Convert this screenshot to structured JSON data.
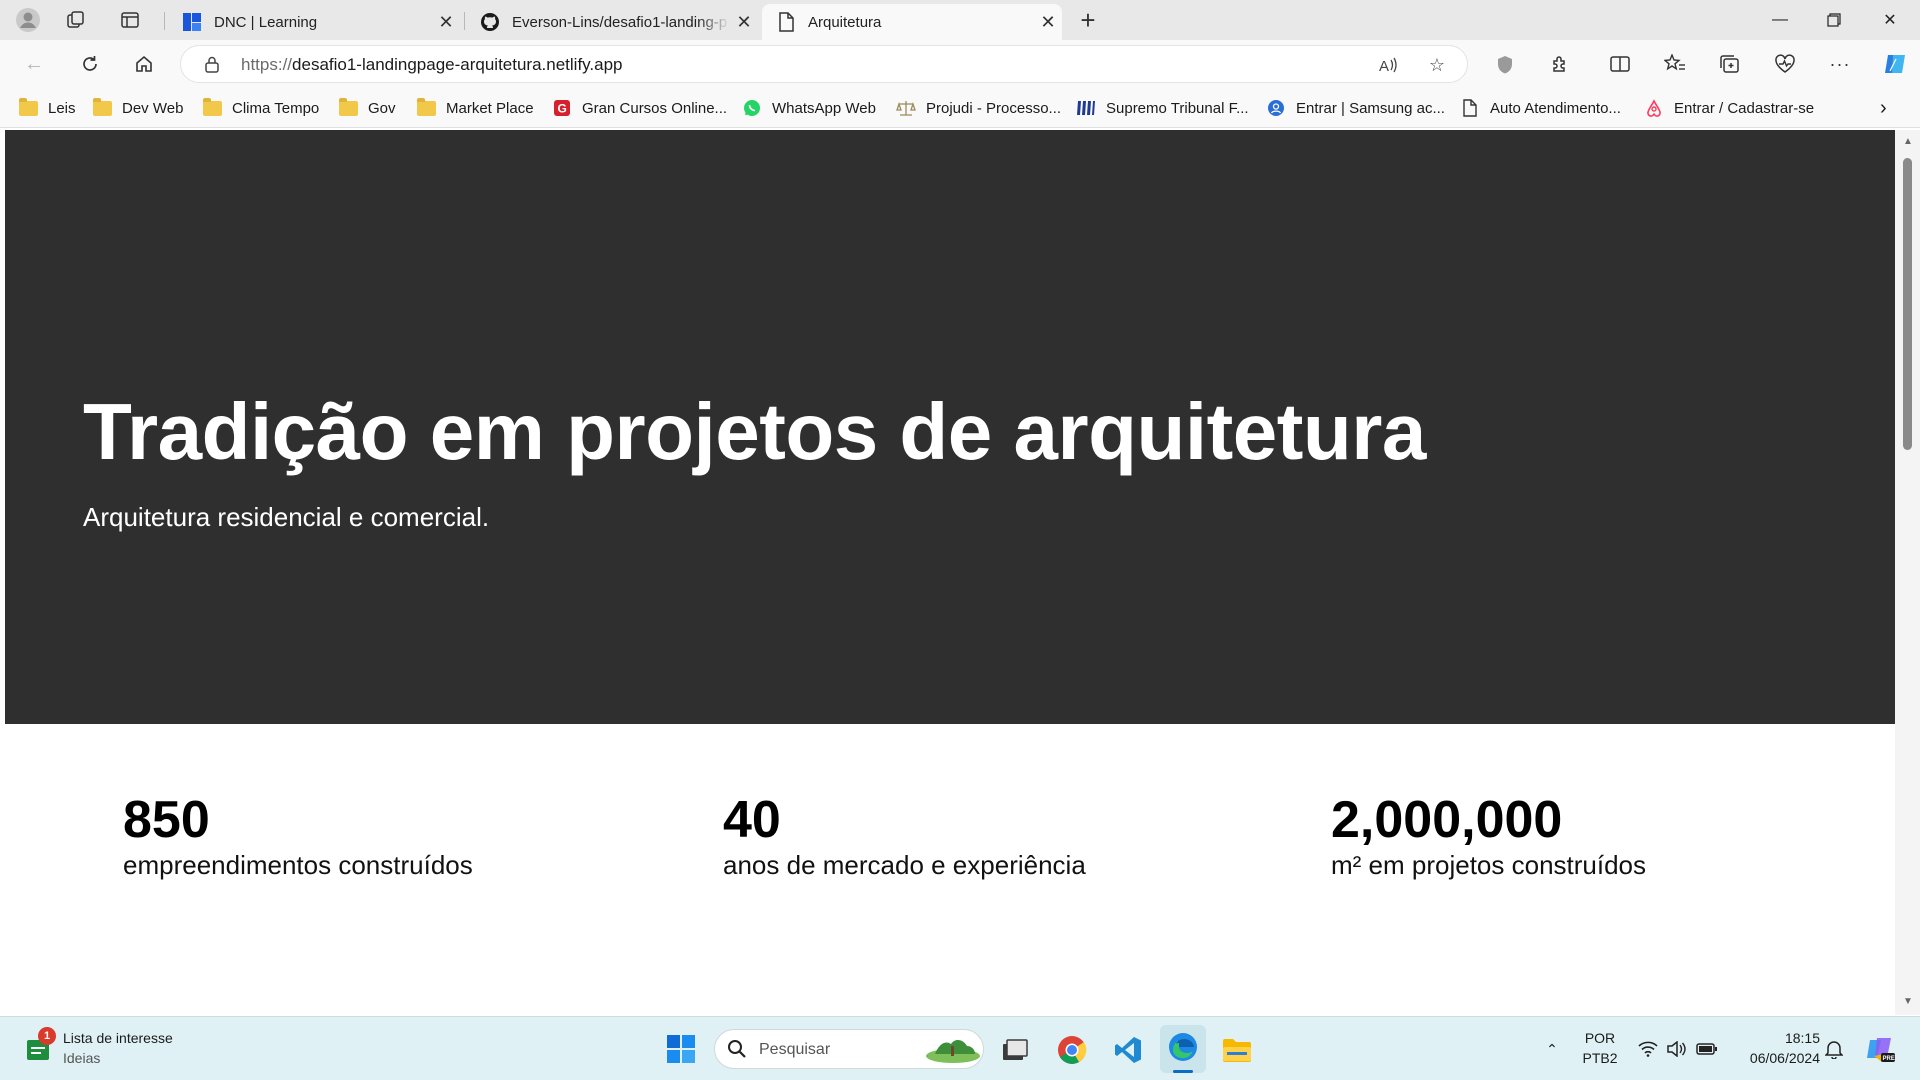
{
  "browser": {
    "tabs": [
      {
        "title": "DNC | Learning",
        "icon": "dnc-icon",
        "active": false
      },
      {
        "title": "Everson-Lins/desafio1-landing-p",
        "icon": "github-icon",
        "active": false
      },
      {
        "title": "Arquitetura",
        "icon": "page-icon",
        "active": true
      }
    ],
    "url_protocol": "https://",
    "url_host": "desafio1-landingpage-arquitetura.netlify.app",
    "bookmarks": [
      {
        "label": "Leis",
        "icon": "folder-icon"
      },
      {
        "label": "Dev Web",
        "icon": "folder-icon"
      },
      {
        "label": "Clima Tempo",
        "icon": "folder-icon"
      },
      {
        "label": "Gov",
        "icon": "folder-icon"
      },
      {
        "label": "Market Place",
        "icon": "folder-icon"
      },
      {
        "label": "Gran Cursos Online...",
        "icon": "gran-cursos-icon"
      },
      {
        "label": "WhatsApp Web",
        "icon": "whatsapp-icon"
      },
      {
        "label": "Projudi - Processo...",
        "icon": "scales-icon"
      },
      {
        "label": "Supremo Tribunal F...",
        "icon": "stf-icon"
      },
      {
        "label": "Entrar | Samsung ac...",
        "icon": "samsung-icon"
      },
      {
        "label": "Auto Atendimento...",
        "icon": "page-icon"
      },
      {
        "label": "Entrar / Cadastrar-se",
        "icon": "airbnb-icon"
      }
    ]
  },
  "hero": {
    "title": "Tradição em projetos de arquitetura",
    "subtitle": "Arquitetura residencial e comercial.",
    "background": "#2f2f2f"
  },
  "stats": [
    {
      "value": "850",
      "label": "empreendimentos construídos"
    },
    {
      "value": "40",
      "label": "anos de mercado e experiência"
    },
    {
      "value": "2,000,000",
      "label": "m² em projetos construídos"
    }
  ],
  "taskbar": {
    "widget_title": "Lista de interesse",
    "widget_subtitle": "Ideias",
    "widget_badge": "1",
    "search_placeholder": "Pesquisar",
    "lang_top": "POR",
    "lang_bottom": "PTB2",
    "time": "18:15",
    "date": "06/06/2024"
  }
}
